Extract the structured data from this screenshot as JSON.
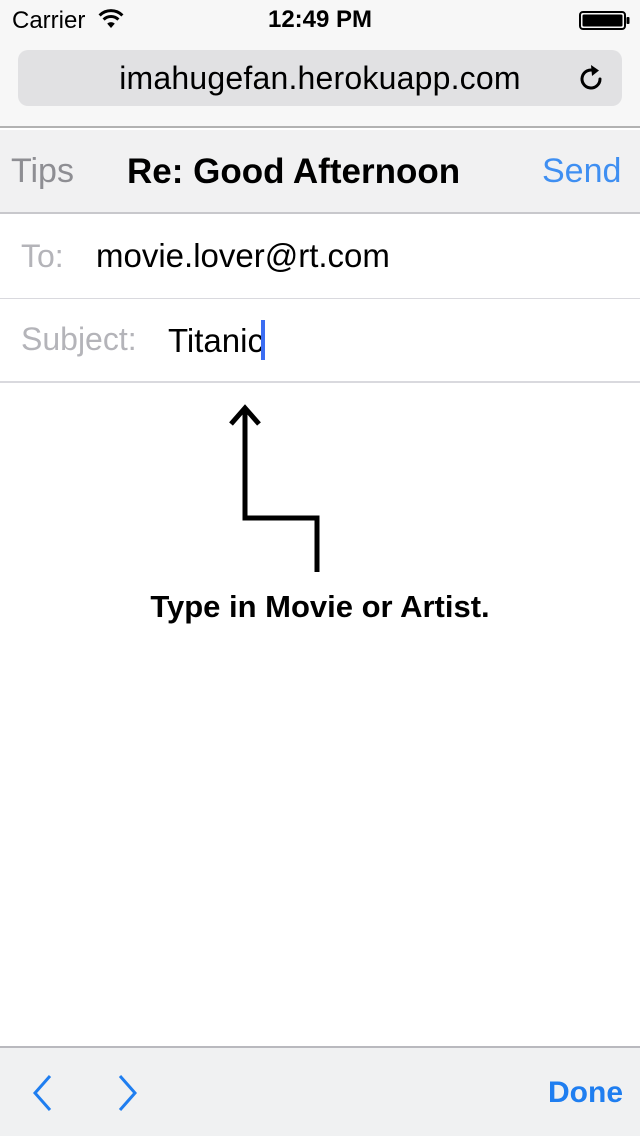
{
  "status_bar": {
    "carrier": "Carrier",
    "time": "12:49 PM",
    "icons": [
      "wifi-icon",
      "battery-icon"
    ]
  },
  "browser": {
    "url": "imahugefan.herokuapp.com",
    "reload_icon": "reload-icon"
  },
  "navbar": {
    "left": "Tips",
    "title": "Re: Good Afternoon",
    "right": "Send"
  },
  "fields": {
    "to_label": "To:",
    "to_value": "movie.lover@rt.com",
    "subject_label": "Subject:",
    "subject_value": "Titanic"
  },
  "hint": {
    "text": "Type in Movie or Artist.",
    "icon": "arrow-up-icon"
  },
  "toolbar": {
    "prev_icon": "chevron-left-icon",
    "next_icon": "chevron-right-icon",
    "done": "Done"
  },
  "colors": {
    "accent": "#3f8ff2",
    "done_blue": "#1f7ef0",
    "cursor": "#3b6df2",
    "muted": "#8e8e93"
  }
}
